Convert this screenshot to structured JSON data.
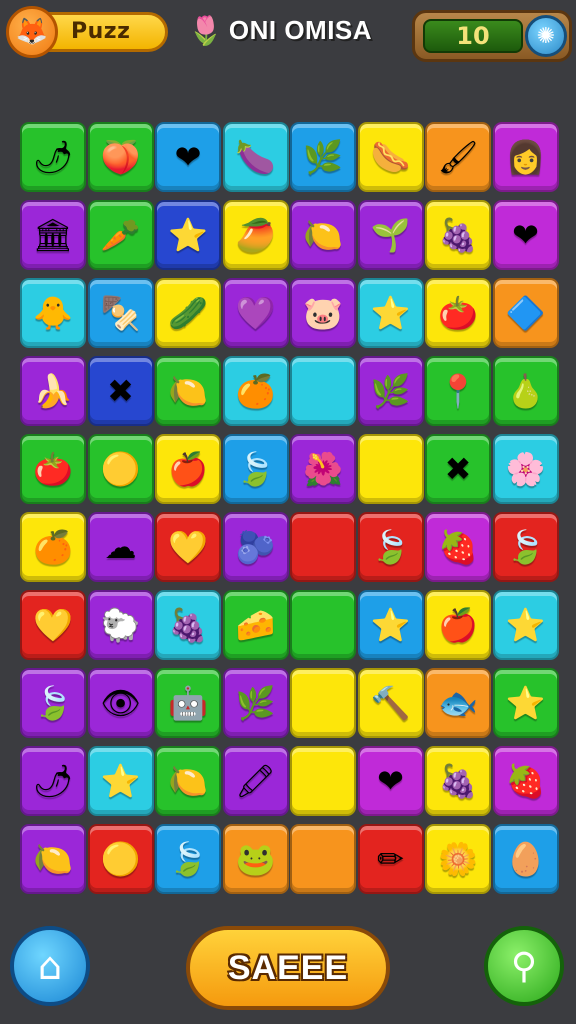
{
  "header": {
    "player_label": "Puzz",
    "avatar_icon": "fox-face-icon",
    "title": "ONI OMISA",
    "title_icon": "tulip-icon",
    "score": "10",
    "score_icon": "gear-icon"
  },
  "board": {
    "rows": 10,
    "cols": 8,
    "tiles": [
      [
        {
          "color": "green",
          "icon": "🌶"
        },
        {
          "color": "green",
          "icon": "🍑"
        },
        {
          "color": "blue",
          "icon": "❤"
        },
        {
          "color": "cyan",
          "icon": "🍆"
        },
        {
          "color": "blue",
          "icon": "🌿"
        },
        {
          "color": "yellow",
          "icon": "🌭"
        },
        {
          "color": "orange",
          "icon": "🖌"
        },
        {
          "color": "magenta",
          "icon": "👩"
        }
      ],
      [
        {
          "color": "purple",
          "icon": "🏛"
        },
        {
          "color": "green",
          "icon": "🥕"
        },
        {
          "color": "navy",
          "icon": "⭐"
        },
        {
          "color": "yellow",
          "icon": "🥭"
        },
        {
          "color": "purple",
          "icon": "🍋"
        },
        {
          "color": "purple",
          "icon": "🌱"
        },
        {
          "color": "yellow",
          "icon": "🍇"
        },
        {
          "color": "magenta",
          "icon": "❤"
        }
      ],
      [
        {
          "color": "cyan",
          "icon": "🐥"
        },
        {
          "color": "blue",
          "icon": "🍢"
        },
        {
          "color": "yellow",
          "icon": "🥒"
        },
        {
          "color": "purple",
          "icon": "💜"
        },
        {
          "color": "purple",
          "icon": "🐷"
        },
        {
          "color": "cyan",
          "icon": "⭐"
        },
        {
          "color": "yellow",
          "icon": "🍅"
        },
        {
          "color": "orange",
          "icon": "🔷"
        }
      ],
      [
        {
          "color": "purple",
          "icon": "🍌"
        },
        {
          "color": "navy",
          "icon": "✖"
        },
        {
          "color": "green",
          "icon": "🍋"
        },
        {
          "color": "cyan",
          "icon": "🍊"
        },
        {
          "color": "cyan",
          "icon": ""
        },
        {
          "color": "purple",
          "icon": "🌿"
        },
        {
          "color": "green",
          "icon": "📍"
        },
        {
          "color": "green",
          "icon": "🍐"
        }
      ],
      [
        {
          "color": "green",
          "icon": "🍅"
        },
        {
          "color": "green",
          "icon": "🟡"
        },
        {
          "color": "yellow",
          "icon": "🍎"
        },
        {
          "color": "blue",
          "icon": "🍃"
        },
        {
          "color": "purple",
          "icon": "🌺"
        },
        {
          "color": "yellow",
          "icon": ""
        },
        {
          "color": "green",
          "icon": "✖"
        },
        {
          "color": "cyan",
          "icon": "🌸"
        }
      ],
      [
        {
          "color": "yellow",
          "icon": "🍊"
        },
        {
          "color": "purple",
          "icon": "☁"
        },
        {
          "color": "red",
          "icon": "💛"
        },
        {
          "color": "purple",
          "icon": "🫐"
        },
        {
          "color": "red",
          "icon": ""
        },
        {
          "color": "red",
          "icon": "🍃"
        },
        {
          "color": "magenta",
          "icon": "🍓"
        },
        {
          "color": "red",
          "icon": "🍃"
        }
      ],
      [
        {
          "color": "red",
          "icon": "💛"
        },
        {
          "color": "purple",
          "icon": "🐑"
        },
        {
          "color": "cyan",
          "icon": "🍇"
        },
        {
          "color": "green",
          "icon": "🧀"
        },
        {
          "color": "green",
          "icon": ""
        },
        {
          "color": "blue",
          "icon": "⭐"
        },
        {
          "color": "yellow",
          "icon": "🍎"
        },
        {
          "color": "cyan",
          "icon": "⭐"
        }
      ],
      [
        {
          "color": "purple",
          "icon": "🍃"
        },
        {
          "color": "purple",
          "icon": "👁"
        },
        {
          "color": "green",
          "icon": "🤖"
        },
        {
          "color": "purple",
          "icon": "🌿"
        },
        {
          "color": "yellow",
          "icon": ""
        },
        {
          "color": "yellow",
          "icon": "🔨"
        },
        {
          "color": "orange",
          "icon": "🐟"
        },
        {
          "color": "green",
          "icon": "⭐"
        }
      ],
      [
        {
          "color": "purple",
          "icon": "🌶"
        },
        {
          "color": "cyan",
          "icon": "⭐"
        },
        {
          "color": "green",
          "icon": "🍋"
        },
        {
          "color": "purple",
          "icon": "🖍"
        },
        {
          "color": "yellow",
          "icon": ""
        },
        {
          "color": "magenta",
          "icon": "❤"
        },
        {
          "color": "yellow",
          "icon": "🍇"
        },
        {
          "color": "magenta",
          "icon": "🍓"
        }
      ],
      [
        {
          "color": "purple",
          "icon": "🍋"
        },
        {
          "color": "red",
          "icon": "🟡"
        },
        {
          "color": "blue",
          "icon": "🍃"
        },
        {
          "color": "orange",
          "icon": "🐸"
        },
        {
          "color": "orange",
          "icon": ""
        },
        {
          "color": "red",
          "icon": "✏"
        },
        {
          "color": "yellow",
          "icon": "🌼"
        },
        {
          "color": "blue",
          "icon": "🥚"
        }
      ]
    ]
  },
  "footer": {
    "home_icon": "home-icon",
    "main_button_label": "SAEEE",
    "search_icon": "search-icon"
  }
}
